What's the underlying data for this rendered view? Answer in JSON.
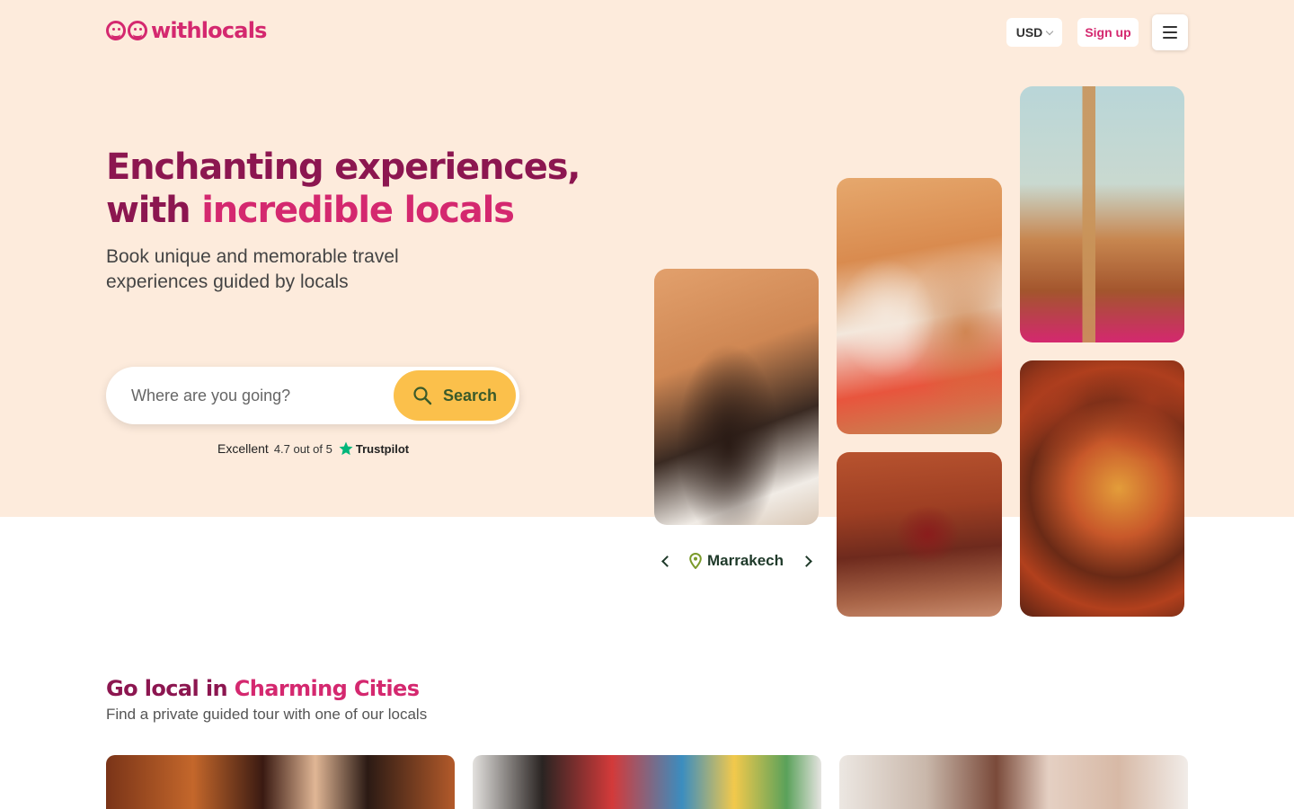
{
  "header": {
    "logo_text": "withlocals",
    "currency": "USD",
    "signup": "Sign up"
  },
  "hero": {
    "title_line1": "Enchanting experiences,",
    "title_line2_plain": "with ",
    "title_line2_accent": "incredible locals",
    "subtitle": "Book unique and memorable travel experiences guided by locals",
    "search_placeholder": "Where are you going?",
    "search_button": "Search",
    "trust_label": "Excellent",
    "trust_rating": "4.7 out of 5",
    "trust_brand": "Trustpilot",
    "city": "Marrakech"
  },
  "section": {
    "title_plain": "Go local in ",
    "title_accent": "Charming Cities",
    "subtitle": "Find a private guided tour with one of our locals"
  },
  "colors": {
    "brand": "#d4286f",
    "brand_dark": "#8c1650",
    "hero_bg": "#fdebdc",
    "search_button": "#fbc04b",
    "trustpilot_star": "#00b67a"
  }
}
